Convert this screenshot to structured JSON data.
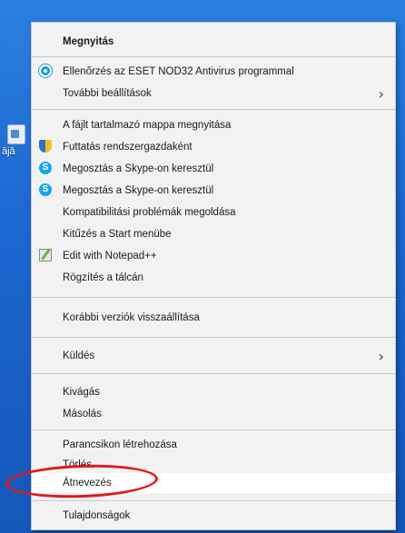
{
  "desktop": {
    "icon_label": "ăjă"
  },
  "context_menu": {
    "items": [
      {
        "label": "Megnyitás",
        "bold": true
      },
      {
        "label": "Ellenőrzés az ESET NOD32 Antivirus programmal",
        "icon": "eset-icon"
      },
      {
        "label": "További beállítások",
        "submenu": true
      },
      {
        "label": "A fájlt tartalmazó mappa megnyitása"
      },
      {
        "label": "Futtatás rendszergazdaként",
        "icon": "shield-icon"
      },
      {
        "label": "Megosztás a Skype-on keresztül",
        "icon": "skype-icon"
      },
      {
        "label": "Megosztás a Skype-on keresztül",
        "icon": "skype-icon"
      },
      {
        "label": "Kompatibilitási problémák megoldása"
      },
      {
        "label": "Kitűzés a Start menübe"
      },
      {
        "label": "Edit with Notepad++",
        "icon": "notepad-icon"
      },
      {
        "label": "Rögzítés a tálcán"
      },
      {
        "label": "Korábbi verziók visszaállítása"
      },
      {
        "label": "Küldés",
        "submenu": true
      },
      {
        "label": "Kivágás"
      },
      {
        "label": "Másolás"
      },
      {
        "label": "Parancsikon létrehozása"
      },
      {
        "label": "Törlés"
      },
      {
        "label": "Átnevezés",
        "highlighted": true
      },
      {
        "label": "Tulajdonságok"
      }
    ],
    "submenu_arrow": "›"
  },
  "annotation": {
    "color": "#e01a1a",
    "target": "Átnevezés"
  }
}
